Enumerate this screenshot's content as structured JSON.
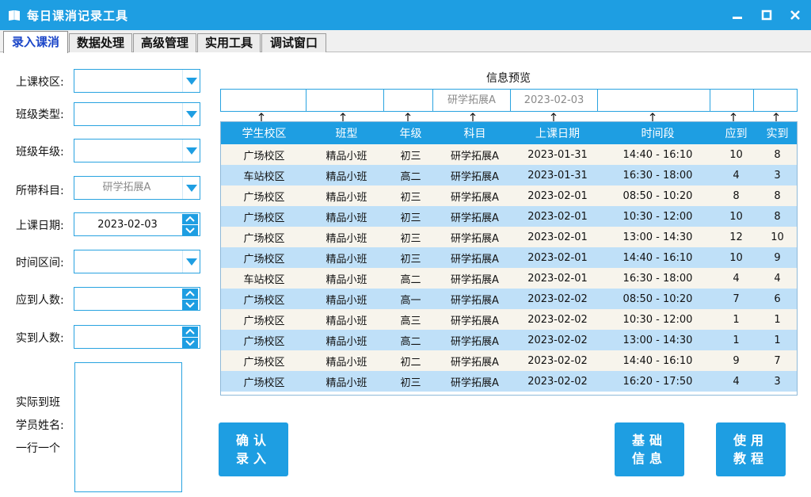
{
  "window": {
    "title": "每日课消记录工具"
  },
  "tabs": [
    {
      "label": "录入课消"
    },
    {
      "label": "数据处理"
    },
    {
      "label": "高级管理"
    },
    {
      "label": "实用工具"
    },
    {
      "label": "调试窗口"
    }
  ],
  "form": {
    "campus_label": "上课校区:",
    "class_type_label": "班级类型:",
    "grade_label": "班级年级:",
    "subject_label": "所带科目:",
    "subject_value": "研学拓展A",
    "date_label": "上课日期:",
    "date_value": "2023-02-03",
    "time_label": "时间区间:",
    "expected_label": "应到人数:",
    "actual_label": "实到人数:",
    "names_label_1": "实际到班",
    "names_label_2": "学员姓名:",
    "names_label_3": "一行一个"
  },
  "preview": {
    "title": "信息预览",
    "cells": [
      "",
      "",
      "",
      "研学拓展A",
      "2023-02-03",
      "",
      "",
      ""
    ]
  },
  "table": {
    "columns": [
      "学生校区",
      "班型",
      "年级",
      "科目",
      "上课日期",
      "时间段",
      "应到",
      "实到"
    ],
    "rows": [
      [
        "广场校区",
        "精品小班",
        "初三",
        "研学拓展A",
        "2023-01-31",
        "14:40 - 16:10",
        "10",
        "8"
      ],
      [
        "车站校区",
        "精品小班",
        "高二",
        "研学拓展A",
        "2023-01-31",
        "16:30 - 18:00",
        "4",
        "3"
      ],
      [
        "广场校区",
        "精品小班",
        "初三",
        "研学拓展A",
        "2023-02-01",
        "08:50 - 10:20",
        "8",
        "8"
      ],
      [
        "广场校区",
        "精品小班",
        "初三",
        "研学拓展A",
        "2023-02-01",
        "10:30 - 12:00",
        "10",
        "8"
      ],
      [
        "广场校区",
        "精品小班",
        "初三",
        "研学拓展A",
        "2023-02-01",
        "13:00 - 14:30",
        "12",
        "10"
      ],
      [
        "广场校区",
        "精品小班",
        "初三",
        "研学拓展A",
        "2023-02-01",
        "14:40 - 16:10",
        "10",
        "9"
      ],
      [
        "车站校区",
        "精品小班",
        "高二",
        "研学拓展A",
        "2023-02-01",
        "16:30 - 18:00",
        "4",
        "4"
      ],
      [
        "广场校区",
        "精品小班",
        "高一",
        "研学拓展A",
        "2023-02-02",
        "08:50 - 10:20",
        "7",
        "6"
      ],
      [
        "广场校区",
        "精品小班",
        "高三",
        "研学拓展A",
        "2023-02-02",
        "10:30 - 12:00",
        "1",
        "1"
      ],
      [
        "广场校区",
        "精品小班",
        "高二",
        "研学拓展A",
        "2023-02-02",
        "13:00 - 14:30",
        "1",
        "1"
      ],
      [
        "广场校区",
        "精品小班",
        "初二",
        "研学拓展A",
        "2023-02-02",
        "14:40 - 16:10",
        "9",
        "7"
      ],
      [
        "广场校区",
        "精品小班",
        "初三",
        "研学拓展A",
        "2023-02-02",
        "16:20 - 17:50",
        "4",
        "3"
      ]
    ]
  },
  "buttons": {
    "confirm_1": "确认",
    "confirm_2": "录入",
    "basic_1": "基础",
    "basic_2": "信息",
    "tutorial_1": "使用",
    "tutorial_2": "教程"
  },
  "colors": {
    "accent": "#1e9ee2",
    "row_odd": "#f7f4ec",
    "row_even": "#bfe0f8",
    "active_tab_text": "#1a45c8"
  }
}
